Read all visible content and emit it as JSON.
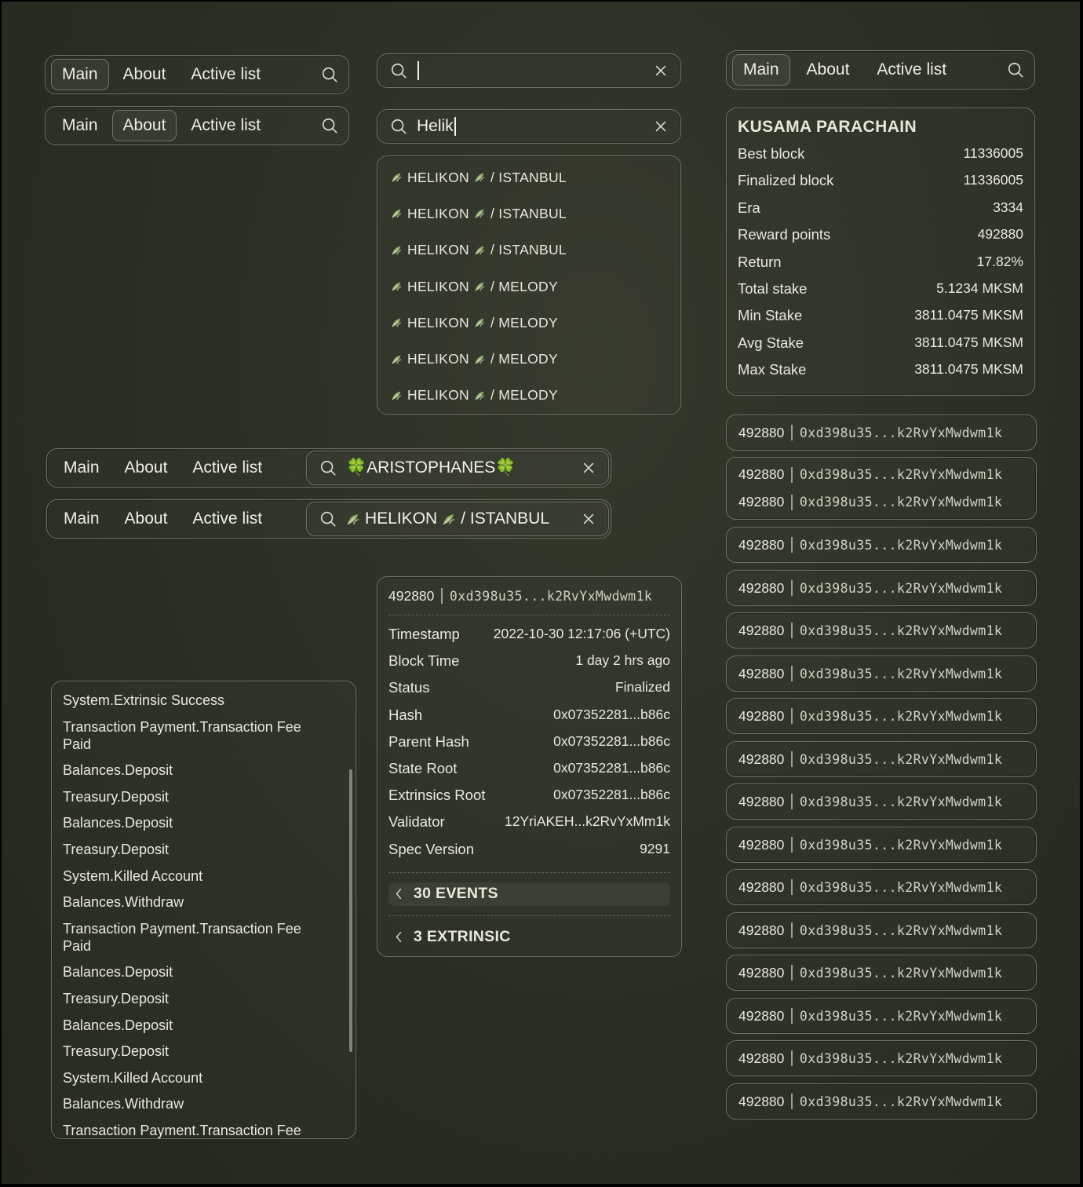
{
  "nav": {
    "main": "Main",
    "about": "About",
    "active_list": "Active list"
  },
  "search": {
    "empty_value": "",
    "typed_value": "Helik",
    "selected_1": "🍀ARISTOPHANES🍀",
    "selected_2_name": "HELIKON",
    "selected_2_suffix": "/ ISTANBUL"
  },
  "dropdown": {
    "items": [
      {
        "name": "HELIKON",
        "suffix": "/ ISTANBUL"
      },
      {
        "name": "HELIKON",
        "suffix": "/ ISTANBUL"
      },
      {
        "name": "HELIKON",
        "suffix": "/ ISTANBUL"
      },
      {
        "name": "HELIKON",
        "suffix": "/ MELODY"
      },
      {
        "name": "HELIKON",
        "suffix": "/ MELODY"
      },
      {
        "name": "HELIKON",
        "suffix": "/ MELODY"
      },
      {
        "name": "HELIKON",
        "suffix": "/ MELODY"
      }
    ]
  },
  "stats": {
    "title": "KUSAMA PARACHAIN",
    "rows": [
      {
        "label": "Best block",
        "value": "11336005"
      },
      {
        "label": "Finalized block",
        "value": "11336005"
      },
      {
        "label": "Era",
        "value": "3334"
      },
      {
        "label": "Reward points",
        "value": "492880"
      },
      {
        "label": "Return",
        "value": "17.82%"
      },
      {
        "label": "Total stake",
        "value": "5.1234 MKSM"
      },
      {
        "label": "Min Stake",
        "value": "3811.0475 MKSM"
      },
      {
        "label": "Avg Stake",
        "value": "3811.0475 MKSM"
      },
      {
        "label": "Max Stake",
        "value": "3811.0475 MKSM"
      }
    ]
  },
  "blocks": {
    "number": "492880",
    "hash": "0xd398u35...k2RvYxMwdwm1k",
    "pills": [
      1,
      2,
      1,
      1,
      1,
      1,
      1,
      1,
      1,
      1,
      1,
      1,
      1,
      1,
      1,
      1
    ]
  },
  "detail": {
    "number": "492880",
    "hash": "0xd398u35...k2RvYxMwdwm1k",
    "rows": [
      {
        "label": "Timestamp",
        "value": "2022-10-30 12:17:06 (+UTC)"
      },
      {
        "label": "Block Time",
        "value": "1 day 2 hrs ago"
      },
      {
        "label": "Status",
        "value": "Finalized"
      },
      {
        "label": "Hash",
        "value": "0x07352281...b86c"
      },
      {
        "label": "Parent Hash",
        "value": "0x07352281...b86c"
      },
      {
        "label": "State Root",
        "value": "0x07352281...b86c"
      },
      {
        "label": "Extrinsics Root",
        "value": "0x07352281...b86c"
      },
      {
        "label": "Validator",
        "value": "12YriAKEH...k2RvYxMm1k"
      },
      {
        "label": "Spec Version",
        "value": "9291"
      }
    ],
    "events_label": "30 EVENTS",
    "extrinsic_label": "3 EXTRINSIC"
  },
  "events": [
    "System.Extrinsic Success",
    "Transaction Payment.Transaction Fee Paid",
    "Balances.Deposit",
    "Treasury.Deposit",
    "Balances.Deposit",
    "Treasury.Deposit",
    "System.Killed Account",
    "Balances.Withdraw",
    "Transaction Payment.Transaction Fee Paid",
    "Balances.Deposit",
    "Treasury.Deposit",
    "Balances.Deposit",
    "Treasury.Deposit",
    "System.Killed Account",
    "Balances.Withdraw",
    "Transaction Payment.Transaction Fee Paid"
  ],
  "colors": {
    "background": "#2a3024",
    "border": "#6e7466",
    "text": "#e6e9dc"
  }
}
